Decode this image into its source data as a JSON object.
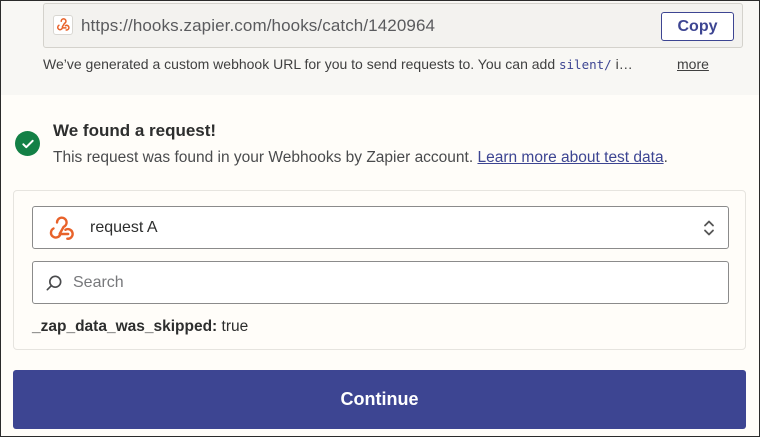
{
  "webhook": {
    "url": "https://hooks.zapier.com/hooks/catch/1420964",
    "copy_label": "Copy",
    "description_prefix": "We’ve generated a custom webhook URL for you to send requests to. You can add ",
    "description_code": "silent/",
    "description_suffix": " i…",
    "more_label": "more",
    "icon": "webhook-icon"
  },
  "status": {
    "title": "We found a request!",
    "message": "This request was found in your Webhooks by Zapier account. ",
    "link_label": "Learn more about test data",
    "message_end": ".",
    "icon": "check-circle-icon",
    "color": "#138046"
  },
  "request_select": {
    "selected": "request A",
    "icon": "webhook-icon"
  },
  "search": {
    "placeholder": "Search",
    "value": ""
  },
  "fields": [
    {
      "key": "_zap_data_was_skipped:",
      "value": "true"
    }
  ],
  "continue_label": "Continue",
  "colors": {
    "accent": "#3d4592",
    "webhook_orange": "#e8622a",
    "success": "#138046"
  }
}
